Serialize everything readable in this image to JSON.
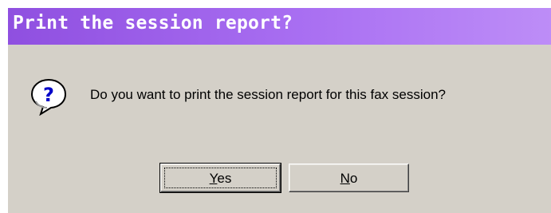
{
  "dialog": {
    "title": "Print the session report?",
    "message": "Do you want to print the session report for this fax session?",
    "icon": "question-icon"
  },
  "buttons": {
    "yes_label": "Yes",
    "no_label": "No"
  },
  "colors": {
    "titlebar_start": "#8f4fe0",
    "titlebar_end": "#bd8df7",
    "dialog_face": "#d4d0c8",
    "title_text": "#ffffff"
  }
}
